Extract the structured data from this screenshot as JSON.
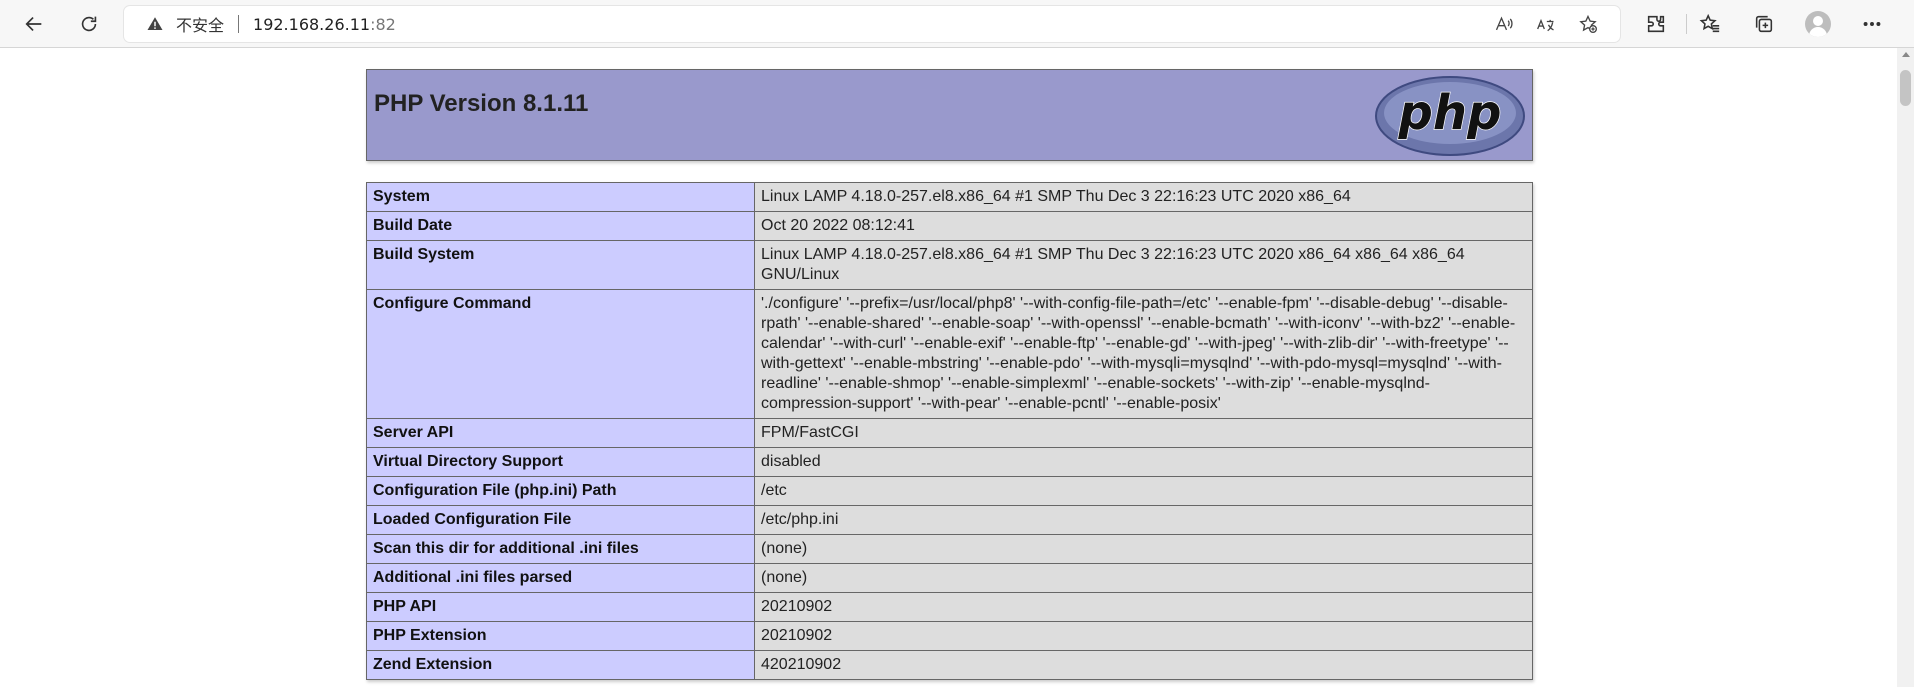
{
  "browser": {
    "security_label": "不安全",
    "url_host": "192.168.26.11",
    "url_port": ":82",
    "icons": [
      "back-icon",
      "refresh-icon",
      "warning-icon",
      "read-aloud-icon",
      "translate-icon",
      "favorite-add-icon",
      "extensions-icon",
      "favorites-icon",
      "collections-icon",
      "profile-avatar",
      "more-icon"
    ]
  },
  "page": {
    "title": "PHP Version 8.1.11",
    "logo_text": "php",
    "rows": [
      {
        "key": "System",
        "value": "Linux LAMP 4.18.0-257.el8.x86_64 #1 SMP Thu Dec 3 22:16:23 UTC 2020 x86_64"
      },
      {
        "key": "Build Date",
        "value": "Oct 20 2022 08:12:41"
      },
      {
        "key": "Build System",
        "value": "Linux LAMP 4.18.0-257.el8.x86_64 #1 SMP Thu Dec 3 22:16:23 UTC 2020 x86_64 x86_64 x86_64 GNU/Linux"
      },
      {
        "key": "Configure Command",
        "value": "'./configure' '--prefix=/usr/local/php8' '--with-config-file-path=/etc' '--enable-fpm' '--disable-debug' '--disable-rpath' '--enable-shared' '--enable-soap' '--with-openssl' '--enable-bcmath' '--with-iconv' '--with-bz2' '--enable-calendar' '--with-curl' '--enable-exif' '--enable-ftp' '--enable-gd' '--with-jpeg' '--with-zlib-dir' '--with-freetype' '--with-gettext' '--enable-mbstring' '--enable-pdo' '--with-mysqli=mysqlnd' '--with-pdo-mysql=mysqlnd' '--with-readline' '--enable-shmop' '--enable-simplexml' '--enable-sockets' '--with-zip' '--enable-mysqlnd-compression-support' '--with-pear' '--enable-pcntl' '--enable-posix'"
      },
      {
        "key": "Server API",
        "value": "FPM/FastCGI"
      },
      {
        "key": "Virtual Directory Support",
        "value": "disabled"
      },
      {
        "key": "Configuration File (php.ini) Path",
        "value": "/etc"
      },
      {
        "key": "Loaded Configuration File",
        "value": "/etc/php.ini"
      },
      {
        "key": "Scan this dir for additional .ini files",
        "value": "(none)"
      },
      {
        "key": "Additional .ini files parsed",
        "value": "(none)"
      },
      {
        "key": "PHP API",
        "value": "20210902"
      },
      {
        "key": "PHP Extension",
        "value": "20210902"
      },
      {
        "key": "Zend Extension",
        "value": "420210902"
      }
    ]
  },
  "colors": {
    "header_bg": "#9999cc",
    "key_bg": "#ccccff",
    "value_bg": "#dddddd"
  }
}
